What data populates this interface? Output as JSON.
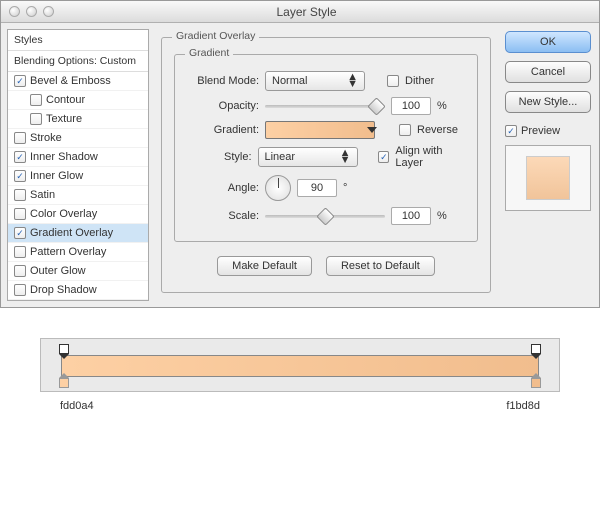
{
  "window": {
    "title": "Layer Style"
  },
  "sidebar": {
    "styles_label": "Styles",
    "blending_label": "Blending Options: Custom",
    "items": [
      {
        "label": "Bevel & Emboss",
        "checked": true
      },
      {
        "label": "Contour",
        "checked": false,
        "indent": true
      },
      {
        "label": "Texture",
        "checked": false,
        "indent": true
      },
      {
        "label": "Stroke",
        "checked": false
      },
      {
        "label": "Inner Shadow",
        "checked": true
      },
      {
        "label": "Inner Glow",
        "checked": true
      },
      {
        "label": "Satin",
        "checked": false
      },
      {
        "label": "Color Overlay",
        "checked": false
      },
      {
        "label": "Gradient Overlay",
        "checked": true,
        "selected": true
      },
      {
        "label": "Pattern Overlay",
        "checked": false
      },
      {
        "label": "Outer Glow",
        "checked": false
      },
      {
        "label": "Drop Shadow",
        "checked": false
      }
    ]
  },
  "panel": {
    "title": "Gradient Overlay",
    "group": "Gradient",
    "blend_mode_label": "Blend Mode:",
    "blend_mode_value": "Normal",
    "dither_label": "Dither",
    "opacity_label": "Opacity:",
    "opacity_value": "100",
    "pct": "%",
    "gradient_label": "Gradient:",
    "reverse_label": "Reverse",
    "style_label": "Style:",
    "style_value": "Linear",
    "align_label": "Align with Layer",
    "angle_label": "Angle:",
    "angle_value": "90",
    "deg": "°",
    "scale_label": "Scale:",
    "scale_value": "100",
    "make_default": "Make Default",
    "reset_default": "Reset to Default"
  },
  "right": {
    "ok": "OK",
    "cancel": "Cancel",
    "new_style": "New Style...",
    "preview_label": "Preview"
  },
  "hex": {
    "left": "fdd0a4",
    "right": "f1bd8d"
  }
}
